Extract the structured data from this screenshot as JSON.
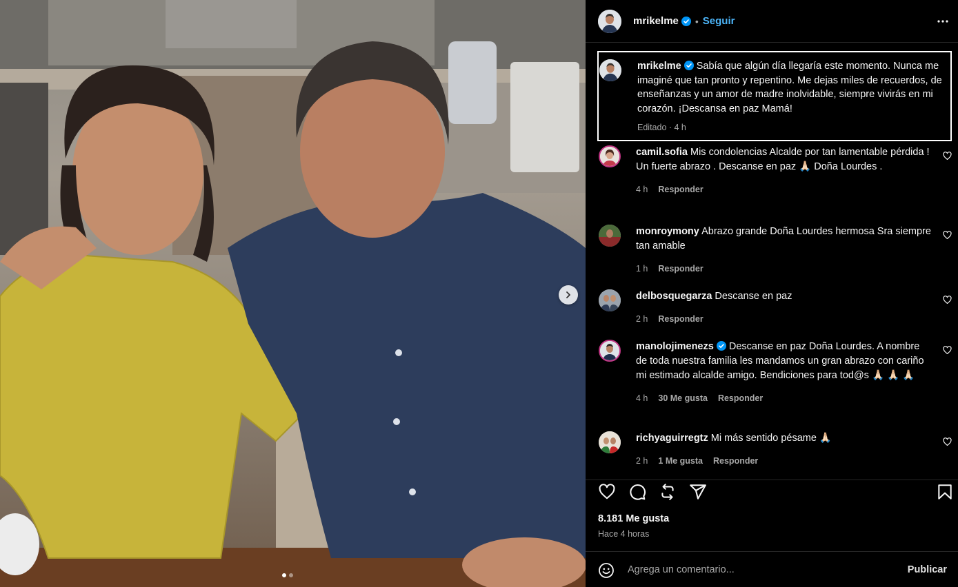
{
  "post": {
    "author": "mrikelme",
    "follow_label": "Seguir",
    "separator": "•",
    "caption": "Sabía que algún día llegaría este momento. Nunca me imaginé que tan pronto y repentino. Me dejas miles de recuerdos, de enseñanzas y un amor de madre inolvidable, siempre vivirás en mi corazón. ¡Descansa en paz Mamá!",
    "caption_meta": "Editado · 4 h",
    "likes": "8.181 Me gusta",
    "posted_ago": "Hace 4 horas",
    "carousel_index": 1,
    "carousel_total": 2
  },
  "comments": [
    {
      "user": "camil.sofia",
      "verified": false,
      "text": "Mis condolencias Alcalde por tan lamentable pérdida ! Un fuerte abrazo . Descanse en paz 🙏🏻 Doña Lourdes .",
      "time": "4 h",
      "likes": "",
      "reply": "Responder"
    },
    {
      "user": "monroymony",
      "verified": false,
      "text": "Abrazo grande Doña Lourdes hermosa Sra siempre tan amable",
      "time": "1 h",
      "likes": "",
      "reply": "Responder"
    },
    {
      "user": "delbosquegarza",
      "verified": false,
      "text": "Descanse en paz",
      "time": "2 h",
      "likes": "",
      "reply": "Responder"
    },
    {
      "user": "manolojimenezs",
      "verified": true,
      "text": "Descanse en paz Doña Lourdes. A nombre de toda nuestra familia les mandamos un gran abrazo con cariño mi estimado alcalde amigo. Bendiciones para tod@s 🙏🏻 🙏🏻 🙏🏻",
      "time": "4 h",
      "likes": "30 Me gusta",
      "reply": "Responder"
    },
    {
      "user": "richyaguirregtz",
      "verified": false,
      "text": "Mi más sentido pésame 🙏🏻",
      "time": "2 h",
      "likes": "1 Me gusta",
      "reply": "Responder"
    }
  ],
  "composer": {
    "placeholder": "Agrega un comentario...",
    "publish_label": "Publicar"
  },
  "icons": {
    "more": "more-options-icon",
    "like": "heart-icon",
    "comment": "comment-icon",
    "share": "repost-icon",
    "send": "send-icon",
    "save": "bookmark-icon",
    "emoji": "emoji-icon",
    "verified": "verified-badge-icon",
    "next": "chevron-right-icon"
  },
  "colors": {
    "background": "#000000",
    "text": "#f5f5f5",
    "muted": "#a8a8a8",
    "link": "#4cb5f9",
    "verified": "#0095f6",
    "divider": "#262626"
  }
}
